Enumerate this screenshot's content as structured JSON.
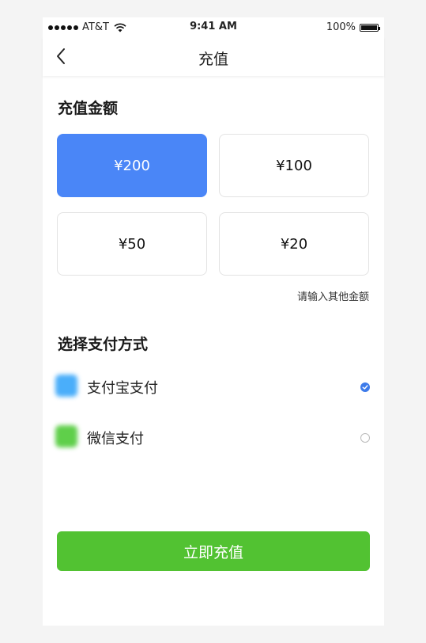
{
  "status_bar": {
    "carrier": "AT&T",
    "time": "9:41 AM",
    "battery": "100%"
  },
  "nav": {
    "title": "充值"
  },
  "amount_section": {
    "title": "充值金额",
    "options": [
      {
        "label": "¥200",
        "selected": true
      },
      {
        "label": "¥100",
        "selected": false
      },
      {
        "label": "¥50",
        "selected": false
      },
      {
        "label": "¥20",
        "selected": false
      }
    ],
    "other_label": "请输入其他金额"
  },
  "payment_section": {
    "title": "选择支付方式",
    "methods": [
      {
        "label": "支付宝支付",
        "selected": true,
        "icon": "alipay-icon",
        "color": "#4aaefa"
      },
      {
        "label": "微信支付",
        "selected": false,
        "icon": "wechat-icon",
        "color": "#5fcf4a"
      }
    ]
  },
  "submit": {
    "label": "立即充值",
    "color": "#52c232"
  },
  "colors": {
    "accent": "#4a86f7",
    "confirm": "#52c232",
    "background": "#f4f4f4"
  }
}
